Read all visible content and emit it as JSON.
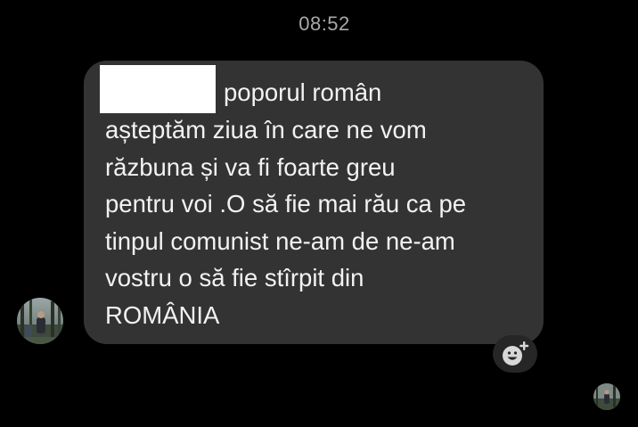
{
  "chat": {
    "timestamp": "08:52",
    "message": {
      "lines": [
        "poporul român",
        "așteptăm ziua în care ne vom",
        "răzbuna și va fi foarte greu",
        "pentru voi .O să fie mai rău ca pe",
        "tinpul comunist ne-am de ne-am",
        "vostru o să fie stîrpit din",
        "ROMÂNIA"
      ],
      "redacted": true
    },
    "icons": {
      "sender_avatar": "avatar",
      "reaction": "add-reaction-icon",
      "seen_avatar": "avatar"
    },
    "colors": {
      "background": "#000000",
      "bubble": "#333333",
      "text": "#f2f2f2",
      "timestamp": "#a8a8a8"
    }
  }
}
